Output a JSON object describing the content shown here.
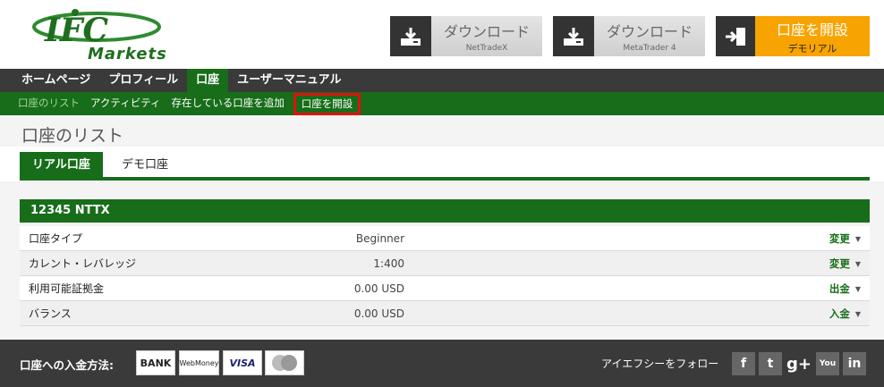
{
  "header": {
    "logo_text": "Markets",
    "download_nettradex": {
      "label": "ダウンロード",
      "sub": "NetTradeX"
    },
    "download_mt4": {
      "label": "ダウンロード",
      "sub": "MetaTrader 4"
    },
    "open_account": {
      "label": "口座を開設",
      "sub": "デモリアル"
    }
  },
  "nav": {
    "items": [
      "ホームページ",
      "プロフィール",
      "口座",
      "ユーザーマニュアル"
    ],
    "active_index": 2
  },
  "subnav": {
    "items": [
      "口座のリスト",
      "アクティビティ",
      "存在している口座を追加",
      "口座を開設"
    ]
  },
  "page_title": "口座のリスト",
  "tabs": {
    "real": "リアル口座",
    "demo": "デモ口座"
  },
  "account": {
    "header": "12345  NTTX",
    "rows": [
      {
        "key": "口座タイプ",
        "value": "Beginner",
        "action": "変更"
      },
      {
        "key": "カレント・レバレッジ",
        "value": "1:400",
        "action": "変更"
      },
      {
        "key": "利用可能証拠金",
        "value": "0.00 USD",
        "action": "出金"
      },
      {
        "key": "バランス",
        "value": "0.00 USD",
        "action": "入金"
      }
    ]
  },
  "footer": {
    "payment_label": "口座への入金方法:",
    "payment_methods": [
      "BANK",
      "WebMoney",
      "VISA",
      "MasterCard"
    ],
    "follow_label": "アイエフシーをフォロー",
    "social": [
      "f",
      "t",
      "g+",
      "You",
      "in"
    ]
  },
  "colors": {
    "green": "#176d19",
    "dark": "#3a3a3a",
    "orange": "#f7a300",
    "highlight": "#e01010"
  }
}
